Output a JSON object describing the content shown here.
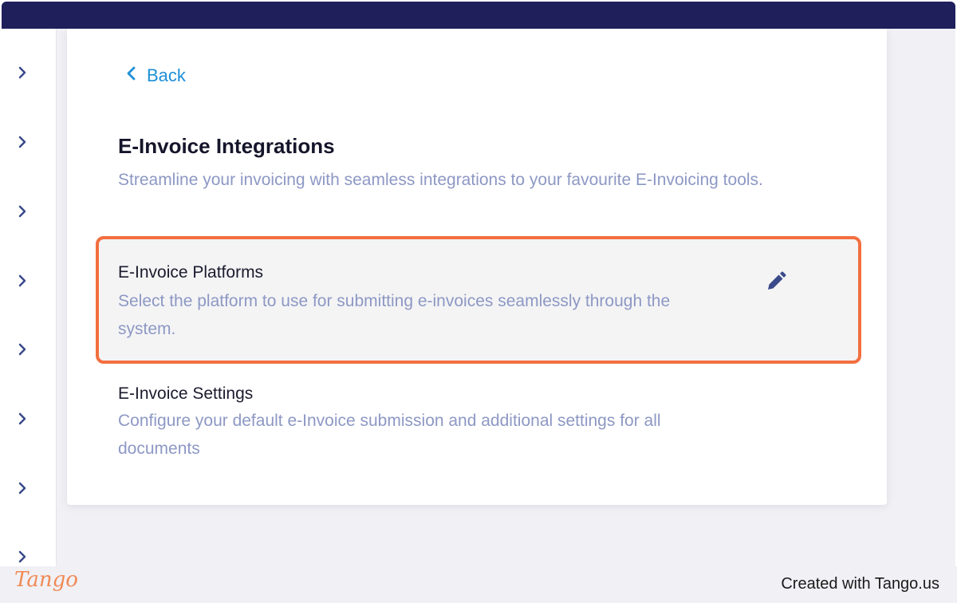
{
  "navigation": {
    "back_label": "Back"
  },
  "page": {
    "title": "E-Invoice Integrations",
    "subtitle": "Streamline your invoicing with seamless integrations to your favourite E-Invoicing tools."
  },
  "sections": [
    {
      "title": "E-Invoice Platforms",
      "description": "Select the platform to use for submitting e-invoices seamlessly through the system.",
      "action_icon": "pencil-icon"
    },
    {
      "title": "E-Invoice Settings",
      "description": "Configure your default e-Invoice submission and additional settings for all documents"
    }
  ],
  "sidebar": {
    "item_icon": "chevron-right-icon",
    "item_count": 8
  },
  "footer": {
    "logo_text": "Tango",
    "credit": "Created with Tango.us"
  },
  "colors": {
    "top_bar": "#1f1f5c",
    "accent_link": "#1e8fd6",
    "highlight_border": "#f26f3f",
    "muted_text": "#8d98c4",
    "icon": "#3a4a8a"
  }
}
